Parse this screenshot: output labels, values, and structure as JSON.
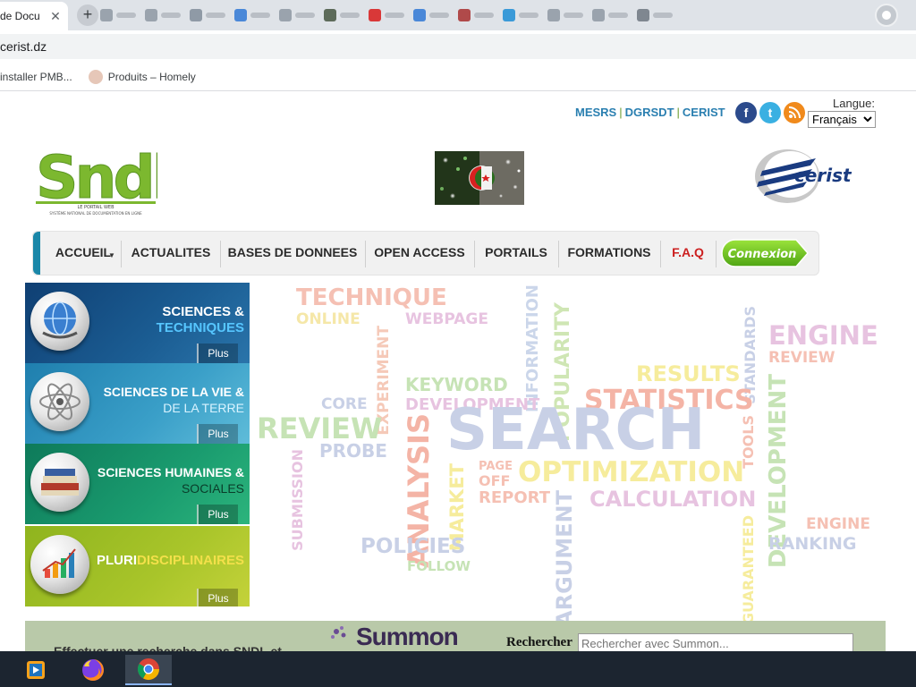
{
  "browser": {
    "active_tab_title": "de Docu",
    "url": "cerist.dz",
    "bookmarks": [
      "installer PMB...",
      "Produits – Homely"
    ]
  },
  "header": {
    "top_links": [
      "MESRS",
      "DGRSDT",
      "CERIST"
    ],
    "langue_label": "Langue:",
    "langue_selected": "Français",
    "social_icons": [
      "facebook-icon",
      "twitter-icon",
      "rss-icon"
    ],
    "sndl_logo_text": "Sndl",
    "sndl_logo_sub1": "LE PORTAIL WEB",
    "sndl_logo_sub2": "SYSTÈME NATIONAL DE DOCUMENTATION EN LIGNE",
    "cerist_logo_text": "cerist"
  },
  "nav": {
    "items": [
      "ACCUEIL",
      "ACTUALITES",
      "BASES DE DONNEES",
      "OPEN ACCESS",
      "PORTAILS",
      "FORMATIONS",
      "F.A.Q"
    ],
    "connexion": "Connexion"
  },
  "categories": [
    {
      "line1": "SCIENCES &",
      "line2": "TECHNIQUES",
      "plus": "Plus"
    },
    {
      "line1": "SCIENCES DE LA VIE &",
      "line2": "DE LA TERRE",
      "plus": "Plus"
    },
    {
      "line1": "SCIENCES HUMAINES &",
      "line2": "SOCIALES",
      "plus": "Plus"
    },
    {
      "line1": "PLURI",
      "line1b": "DISCIPLINAIRES",
      "plus": "Plus"
    }
  ],
  "wordcloud": {
    "words": [
      "TECHNIQUE",
      "ONLINE",
      "WEBPAGE",
      "EXPERIMENT",
      "INFORMATION",
      "POPULARITY",
      "STANDARDS",
      "ENGINE",
      "REVIEW",
      "KEYWORD",
      "RESULTS",
      "CORE",
      "DEVELOPMENT",
      "STATISTICS",
      "REVIEW",
      "SEARCH",
      "TOOLS",
      "DEVELOPMENT",
      "PROBE",
      "ANALYSIS",
      "PAGE",
      "OFF",
      "OPTIMIZATION",
      "SUBMISSION",
      "MARKET",
      "REPORT",
      "CALCULATION",
      "ENGINE",
      "ARGUMENT",
      "GUARANTEED",
      "RANKING",
      "POLICIES",
      "FOLLOW"
    ]
  },
  "search": {
    "label": "Rechercher",
    "placeholder": "Rechercher avec Summon...",
    "summon_logo": "Summon",
    "banner_text": "Effectuer une recherche dans SNDL et"
  },
  "taskbar": [
    "media-player-icon",
    "firefox-icon",
    "chrome-icon"
  ]
}
